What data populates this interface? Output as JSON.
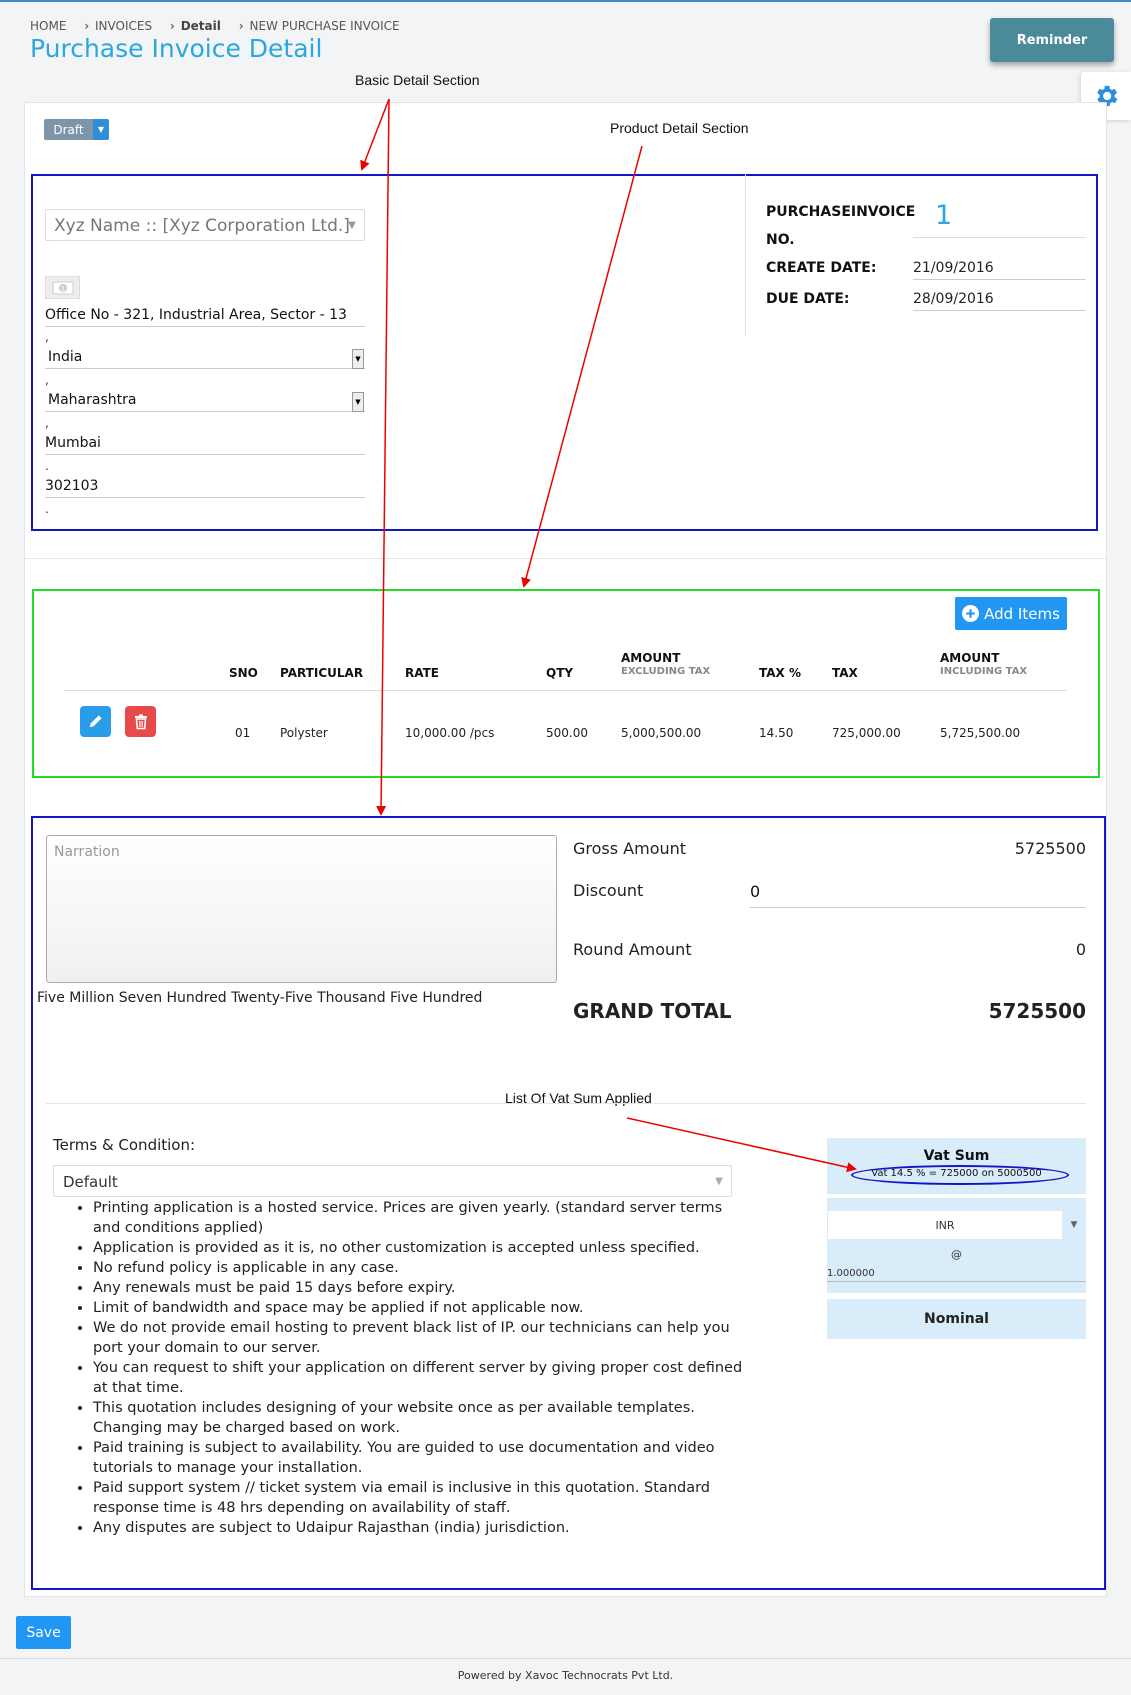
{
  "breadcrumb": {
    "home": "HOME",
    "invoices": "INVOICES",
    "sep1": "›",
    "detail": "Detail",
    "sep2": "›",
    "current": "NEW PURCHASE INVOICE"
  },
  "page_title": "Purchase Invoice Detail",
  "reminder_label": "Reminder",
  "status": {
    "value": "Draft"
  },
  "annotations": {
    "basic_detail": "Basic Detail Section",
    "product_detail": "Product Detail Section",
    "vat_sum_list": "List Of Vat Sum Applied"
  },
  "party": {
    "select_value": "Xyz Name :: [Xyz Corporation Ltd.]",
    "address": "Office No - 321, Industrial Area, Sector - 13",
    "country": "India",
    "state": "Maharashtra",
    "city": "Mumbai",
    "pincode": "302103",
    "comma": ",",
    "dot": "."
  },
  "meta": {
    "invoice_no_label_1": "PURCHASEINVOICE",
    "invoice_no_label_2": "NO.",
    "invoice_no_value": "1",
    "create_date_label": "CREATE DATE:",
    "create_date_value": "21/09/2016",
    "due_date_label": "DUE DATE:",
    "due_date_value": "28/09/2016"
  },
  "items": {
    "add_label": "Add Items",
    "columns": {
      "sno": "SNO",
      "particular": "PARTICULAR",
      "rate": "RATE",
      "qty": "QTY",
      "amount_ex": "AMOUNT",
      "amount_ex_sub": "EXCLUDING TAX",
      "tax_pct": "TAX %",
      "tax": "TAX",
      "amount_inc": "AMOUNT",
      "amount_inc_sub": "INCLUDING TAX"
    },
    "rows": [
      {
        "sno": "01",
        "particular": "Polyster",
        "rate": "10,000.00  /pcs",
        "qty": "500.00",
        "amount_ex": "5,000,500.00",
        "tax_pct": "14.50",
        "tax": "725,000.00",
        "amount_inc": "5,725,500.00"
      }
    ]
  },
  "totals": {
    "narration_placeholder": "Narration",
    "amount_in_words": "Five Million Seven Hundred Twenty-Five Thousand Five Hundred",
    "gross_label": "Gross Amount",
    "gross_value": "5725500",
    "discount_label": "Discount",
    "discount_value": "0",
    "round_label": "Round Amount",
    "round_value": "0",
    "grand_label": "GRAND TOTAL",
    "grand_value": "5725500"
  },
  "terms": {
    "label": "Terms & Condition:",
    "selected": "Default",
    "items": [
      "Printing application is a hosted service. Prices are given yearly. (standard server terms and conditions applied)",
      "Application is provided as it is, no other customization is accepted unless specified.",
      "No refund policy is applicable in any case.",
      "Any renewals must be paid 15 days before expiry.",
      "Limit of bandwidth and space may be applied if not applicable now.",
      "We do not provide email hosting to prevent black list of IP. our technicians can help you port your domain to our server.",
      "You can request to shift your application on different server by giving proper cost defined at that time.",
      "This quotation includes designing of your website once as per available templates. Changing may be charged based on work.",
      "Paid training is subject to availability. You are guided to use documentation and video tutorials to manage your installation.",
      "Paid support system // ticket system via email is inclusive in this quotation. Standard response time is 48 hrs depending on availability of staff.",
      "Any disputes are subject to Udaipur Rajasthan (india) jurisdiction."
    ]
  },
  "vat": {
    "title": "Vat Sum",
    "line": "Vat 14.5 % = 725000 on 5000500"
  },
  "currency": {
    "selected": "INR",
    "at": "@",
    "rate": "1.000000"
  },
  "nominal_label": "Nominal",
  "save_label": "Save",
  "footer_text": "Powered by Xavoc Technocrats Pvt Ltd.",
  "colors": {
    "accent": "#2ba7e0",
    "primary_button": "#2196f3",
    "annotation_blue": "#1414c8",
    "annotation_green": "#22dd22",
    "arrow_red": "#ee0000"
  }
}
